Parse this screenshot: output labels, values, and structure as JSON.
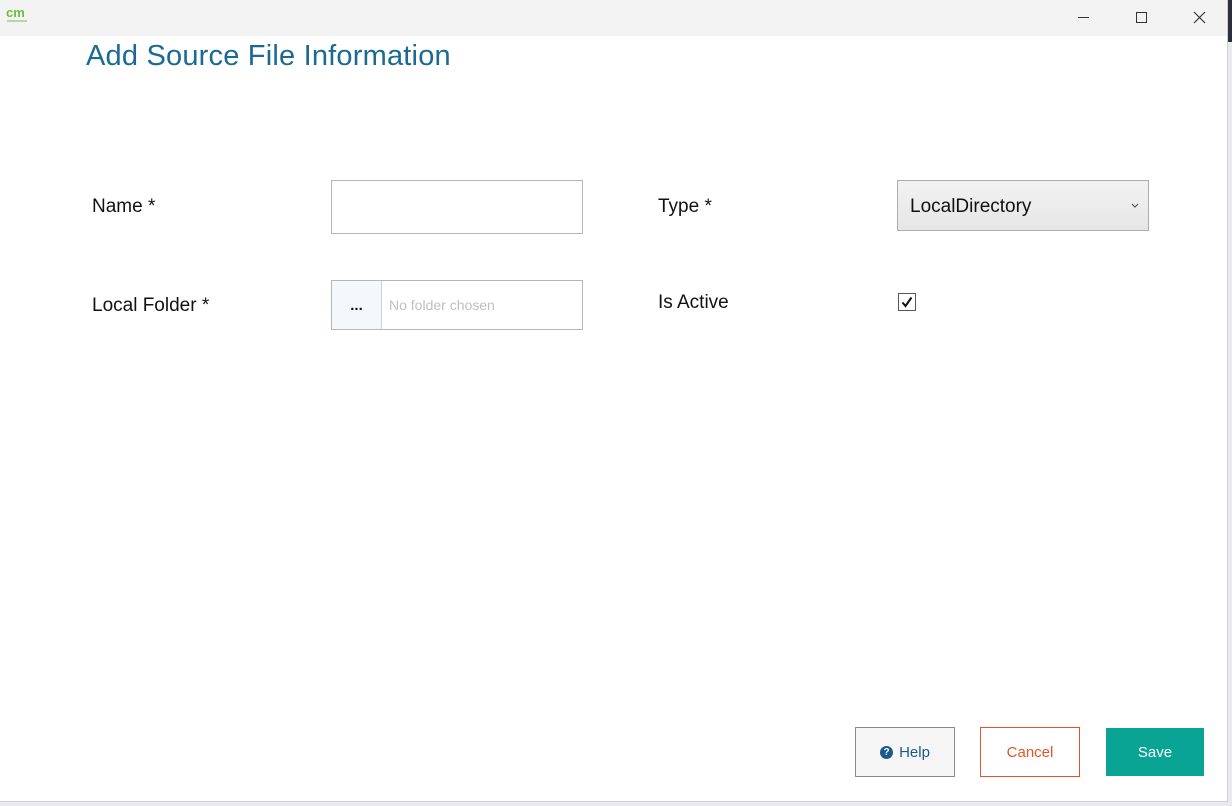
{
  "window": {
    "logo_text": "cm",
    "minimize_icon": "minimize-icon",
    "maximize_icon": "maximize-icon",
    "close_icon": "close-icon"
  },
  "page": {
    "title": "Add Source File Information"
  },
  "form": {
    "name_label": "Name *",
    "name_value": "",
    "folder_label": "Local Folder *",
    "browse_label": "...",
    "folder_placeholder": "No folder chosen",
    "type_label": "Type *",
    "type_value": "LocalDirectory",
    "active_label": "Is Active",
    "active_checked": true
  },
  "actions": {
    "help_label": "Help",
    "cancel_label": "Cancel",
    "save_label": "Save"
  },
  "colors": {
    "title": "#1a6a94",
    "save_bg": "#0aa495",
    "cancel": "#e0562a",
    "help": "#1a5a8a",
    "logo": "#6cbf3c"
  }
}
